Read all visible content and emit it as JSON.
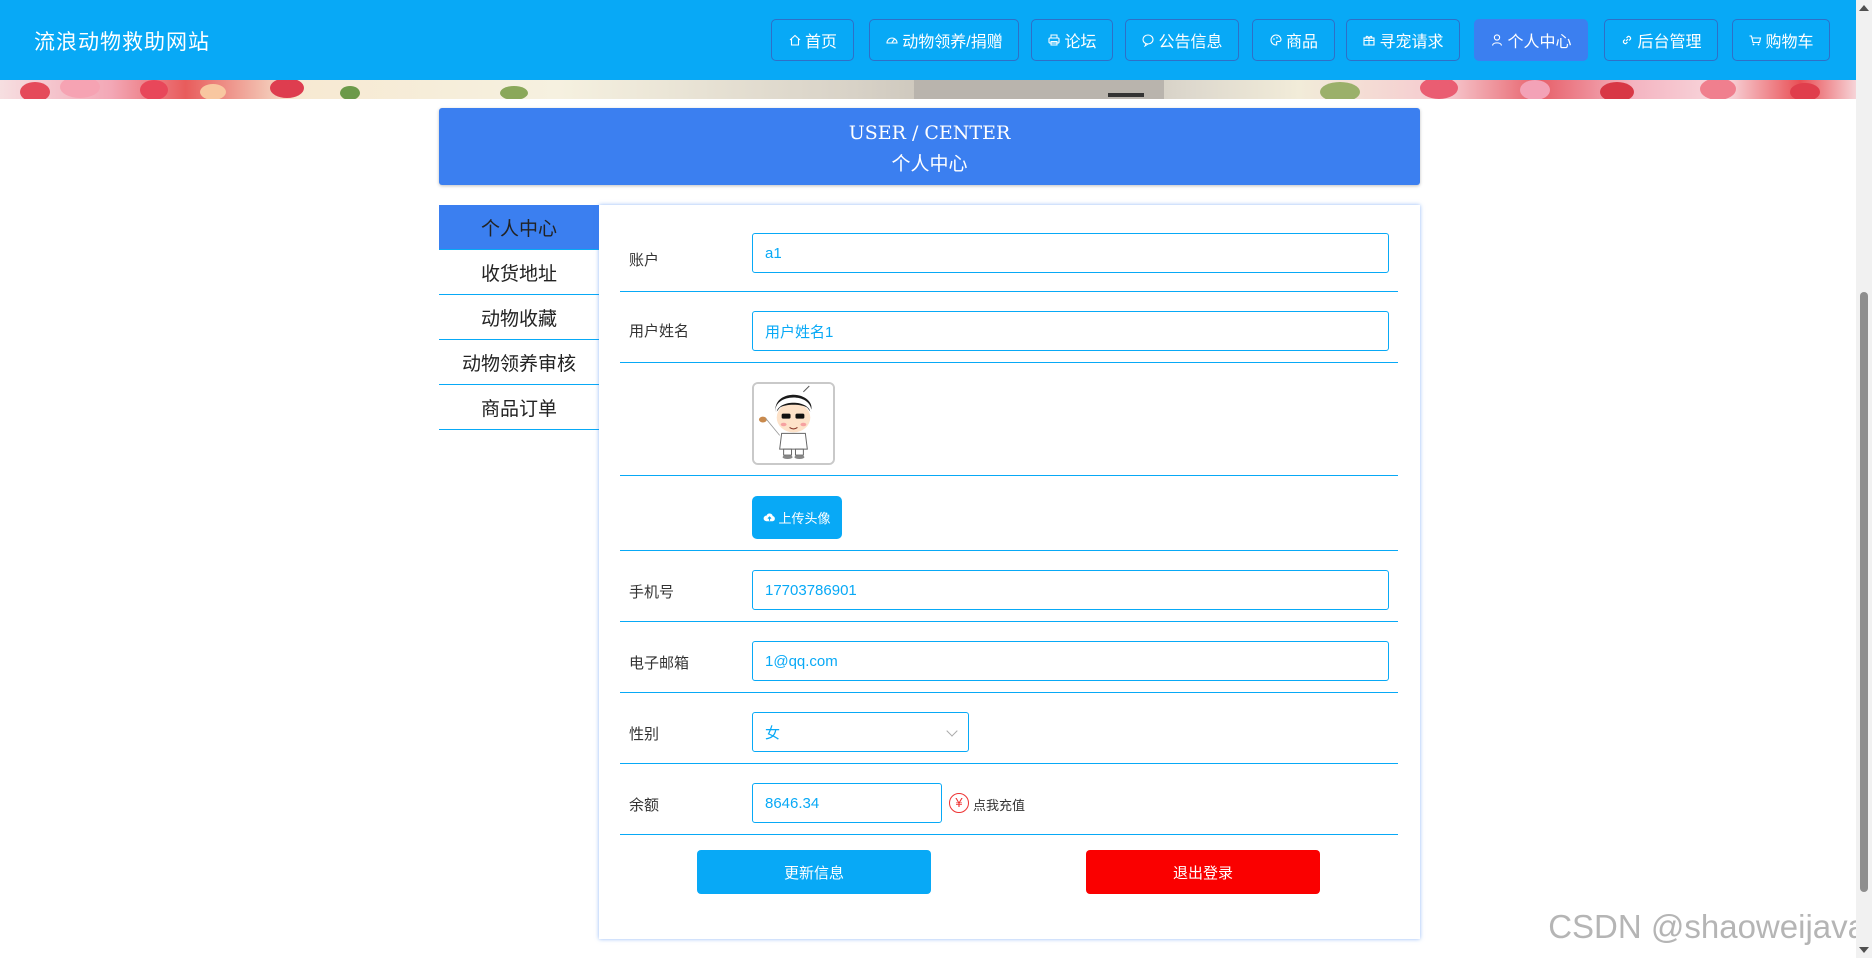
{
  "site": {
    "title": "流浪动物救助网站"
  },
  "nav": [
    {
      "label": "首页",
      "icon": "home-icon"
    },
    {
      "label": "动物领养/捐赠",
      "icon": "gauge-icon"
    },
    {
      "label": "论坛",
      "icon": "printer-icon"
    },
    {
      "label": "公告信息",
      "icon": "chat-bubble-icon"
    },
    {
      "label": "商品",
      "icon": "palette-icon"
    },
    {
      "label": "寻宠请求",
      "icon": "gift-icon"
    },
    {
      "label": "个人中心",
      "icon": "user-icon",
      "active": true
    },
    {
      "label": "后台管理",
      "icon": "link-icon"
    },
    {
      "label": "购物车",
      "icon": "cart-icon"
    }
  ],
  "header": {
    "title_en": "USER / CENTER",
    "title_cn": "个人中心"
  },
  "menu": [
    {
      "label": "个人中心",
      "active": true
    },
    {
      "label": "收货地址"
    },
    {
      "label": "动物收藏"
    },
    {
      "label": "动物领养审核"
    },
    {
      "label": "商品订单"
    }
  ],
  "form": {
    "account": {
      "label": "账户",
      "value": "a1"
    },
    "username": {
      "label": "用户姓名",
      "value": "用户姓名1"
    },
    "avatar": {
      "icon": "cartoon-boy-avatar-icon"
    },
    "upload": {
      "label": "上传头像",
      "icon": "cloud-upload-icon"
    },
    "phone": {
      "label": "手机号",
      "value": "17703786901"
    },
    "email": {
      "label": "电子邮箱",
      "value": "1@qq.com"
    },
    "gender": {
      "label": "性别",
      "value": "女"
    },
    "balance": {
      "label": "余额",
      "value": "8646.34",
      "recharge_label": "点我充值",
      "recharge_icon": "yuan-icon"
    },
    "update_button": "更新信息",
    "logout_button": "退出登录"
  },
  "watermark": "CSDN @shaoweijava",
  "colors": {
    "primary": "#08a9f6",
    "accent": "#3b7ff0",
    "danger": "#fa0000"
  }
}
